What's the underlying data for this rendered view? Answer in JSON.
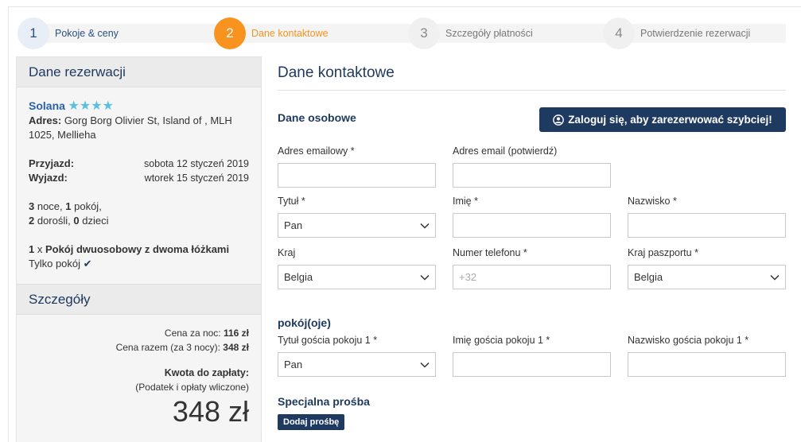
{
  "steps": [
    {
      "num": "1",
      "label": "Pokoje & ceny",
      "state": "done"
    },
    {
      "num": "2",
      "label": "Dane kontaktowe",
      "state": "active"
    },
    {
      "num": "3",
      "label": "Szczegóły płatności",
      "state": "todo"
    },
    {
      "num": "4",
      "label": "Potwierdzenie rezerwacji",
      "state": "todo"
    }
  ],
  "sidebar": {
    "booking_title": "Dane rezerwacji",
    "hotel_name": "Solana",
    "stars": "★★★★",
    "address_label": "Adres:",
    "address": "Gorg Borg Olivier St, Island of , MLH 1025, Mellieha",
    "checkin_label": "Przyjazd:",
    "checkin_value": "sobota 12 styczeń 2019",
    "checkout_label": "Wyjazd:",
    "checkout_value": "wtorek 15 styczeń 2019",
    "nights": "3",
    "nights_text": " noce, ",
    "rooms": "1",
    "rooms_text": " pokój,",
    "adults": "2",
    "adults_text": " dorośli, ",
    "children": "0",
    "children_text": " dzieci",
    "room_qty": "1",
    "room_x": " x ",
    "room_name": "Pokój dwuosobowy z dwoma łóżkami",
    "room_only": "Tylko pokój",
    "details_title": "Szczegóły",
    "price_night_label": "Cena za noc: ",
    "price_night": "116 zł",
    "price_total_label": "Cena razem (za 3 nocy): ",
    "price_total": "348 zł",
    "due_label": "Kwota do zapłaty:",
    "tax_note": "(Podatek i opłaty wliczone)",
    "total": "348 zł"
  },
  "main": {
    "title": "Dane kontaktowe",
    "personal_title": "Dane osobowe",
    "login_button": "Zaloguj się, aby zarezerwować szybciej!",
    "email_label": "Adres emailowy *",
    "email_value": "",
    "email_confirm_label": "Adres email (potwierdź)",
    "email_confirm_value": "",
    "title_label": "Tytuł *",
    "title_value": "Pan",
    "first_name_label": "Imię *",
    "last_name_label": "Nazwisko *",
    "country_label": "Kraj",
    "country_value": "Belgia",
    "phone_label": "Numer telefonu *",
    "phone_placeholder": "+32",
    "passport_label": "Kraj paszportu *",
    "passport_value": "Belgia",
    "rooms_title": "pokój(oje)",
    "guest_title_label": "Tytuł gościa pokoju 1 *",
    "guest_title_value": "Pan",
    "guest_first_label": "Imię gościa pokoju 1 *",
    "guest_last_label": "Nazwisko gościa pokoju 1 *",
    "special_title": "Specjalna prośba",
    "add_request": "Dodaj prośbę"
  },
  "colors": {
    "accent": "#f7931e",
    "primary": "#1f3a60",
    "star": "#5bc0de"
  }
}
